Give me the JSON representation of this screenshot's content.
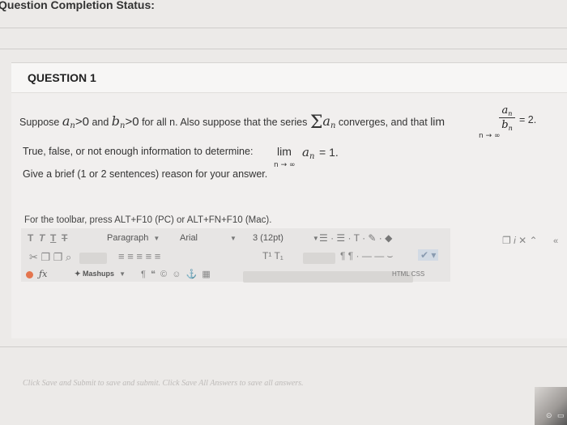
{
  "status": {
    "title": "Question Completion Status:"
  },
  "question": {
    "header": "QUESTION 1",
    "line1_prefix": "Suppose",
    "a": "a",
    "b": "b",
    "sub_n": "n",
    "gt0": ">0",
    "and": "and",
    "for_all": "for all n. Also suppose that the series",
    "sigma": "Σ",
    "converges": "converges, and that",
    "lim": "lim",
    "n_to_inf": "n → ∞",
    "eq_two": "= 2.",
    "line2": "True, false, or not enough information to determine:",
    "eq_one": "= 1.",
    "line3": "Give a brief (1 or 2 sentences) reason for your answer."
  },
  "editor": {
    "note": "For the toolbar, press ALT+F10 (PC) or ALT+FN+F10 (Mac).",
    "format_buttons": [
      "T",
      "T",
      "T",
      "T"
    ],
    "paragraph": "Paragraph",
    "font": "Arial",
    "size": "3 (12pt)",
    "mashups": "Mashups",
    "html_css": "HTML CSS",
    "sup_sub": "T¹ T₁"
  },
  "footer": {
    "text": "Click Save and Submit to save and submit. Click Save All Answers to save all answers."
  },
  "colors": {
    "page_bg": "#eceae8",
    "accent_orange": "#e4754e"
  }
}
